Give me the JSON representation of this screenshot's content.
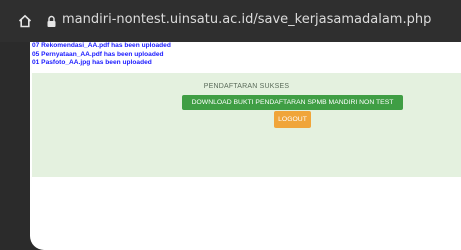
{
  "browser": {
    "url": "mandiri-nontest.uinsatu.ac.id/save_kerjasamadalam.php"
  },
  "uploads": [
    "07 Rekomendasi_AA.pdf has been uploaded",
    "05 Pernyataan_AA.pdf has been uploaded",
    "01 Pasfoto_AA.jpg has been uploaded"
  ],
  "panel": {
    "title": "PENDAFTARAN SUKSES",
    "download_label": "DOWNLOAD BUKTI PENDAFTARAN SPMB MANDIRI NON TEST",
    "logout_label": "LOGOUT"
  },
  "colors": {
    "panel_bg": "#e4f1df",
    "download_btn": "#3f9e44",
    "logout_btn": "#f0a53a",
    "upload_text": "#1a1aff"
  }
}
